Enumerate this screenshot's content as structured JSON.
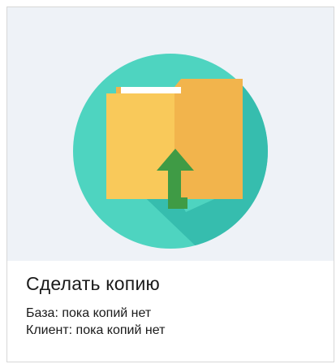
{
  "card": {
    "icon": "folder-upload-icon",
    "title": "Сделать копию",
    "base_status": "База: пока копий нет",
    "client_status": "Клиент: пока копий нет"
  },
  "colors": {
    "illustration_bg": "#eef2f7",
    "circle": "#4ed4c0",
    "folder_front": "#f9c95a",
    "folder_back": "#f2b44c",
    "arrow": "#3f9b45"
  }
}
